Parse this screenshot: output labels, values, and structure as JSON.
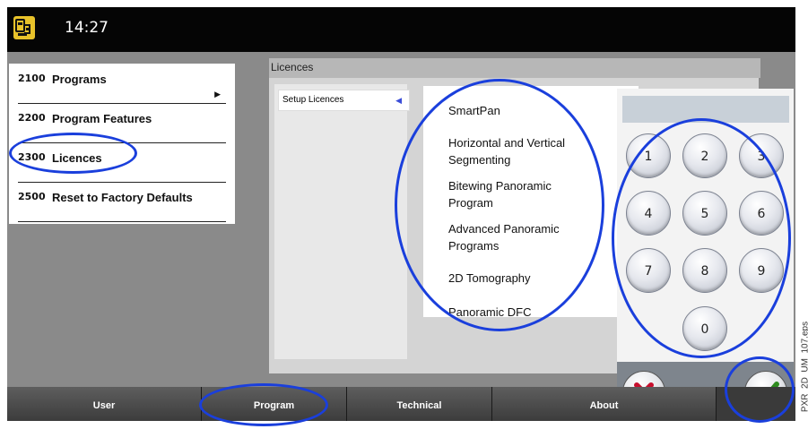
{
  "status_bar": {
    "time": "14:27",
    "app_icon": "device-settings-icon"
  },
  "menu": {
    "items": [
      {
        "code": "2100",
        "label": "Programs"
      },
      {
        "code": "2200",
        "label": "Program Features"
      },
      {
        "code": "2300",
        "label": "Licences"
      },
      {
        "code": "2500",
        "label": "Reset to Factory Defaults"
      }
    ]
  },
  "licences_window": {
    "title": "Licences",
    "setup_item": "Setup Licences",
    "licences": [
      "SmartPan",
      "Horizontal and Vertical Segmenting",
      "Bitewing Panoramic Program",
      "Advanced Panoramic Programs",
      "2D Tomography",
      "Panoramic DFC"
    ]
  },
  "keypad": {
    "keys": [
      "1",
      "2",
      "3",
      "4",
      "5",
      "6",
      "7",
      "8",
      "9",
      "0"
    ],
    "cancel_icon": "x-cancel-icon",
    "confirm_icon": "checkmark-confirm-icon",
    "colors": {
      "cancel": "#c8102e",
      "confirm": "#2e8b1f"
    }
  },
  "tabs": [
    "User",
    "Program",
    "Technical",
    "About"
  ],
  "side_label": "PXR_2D_UM_107.eps",
  "colors": {
    "highlight_ring": "#1a3fdc"
  }
}
